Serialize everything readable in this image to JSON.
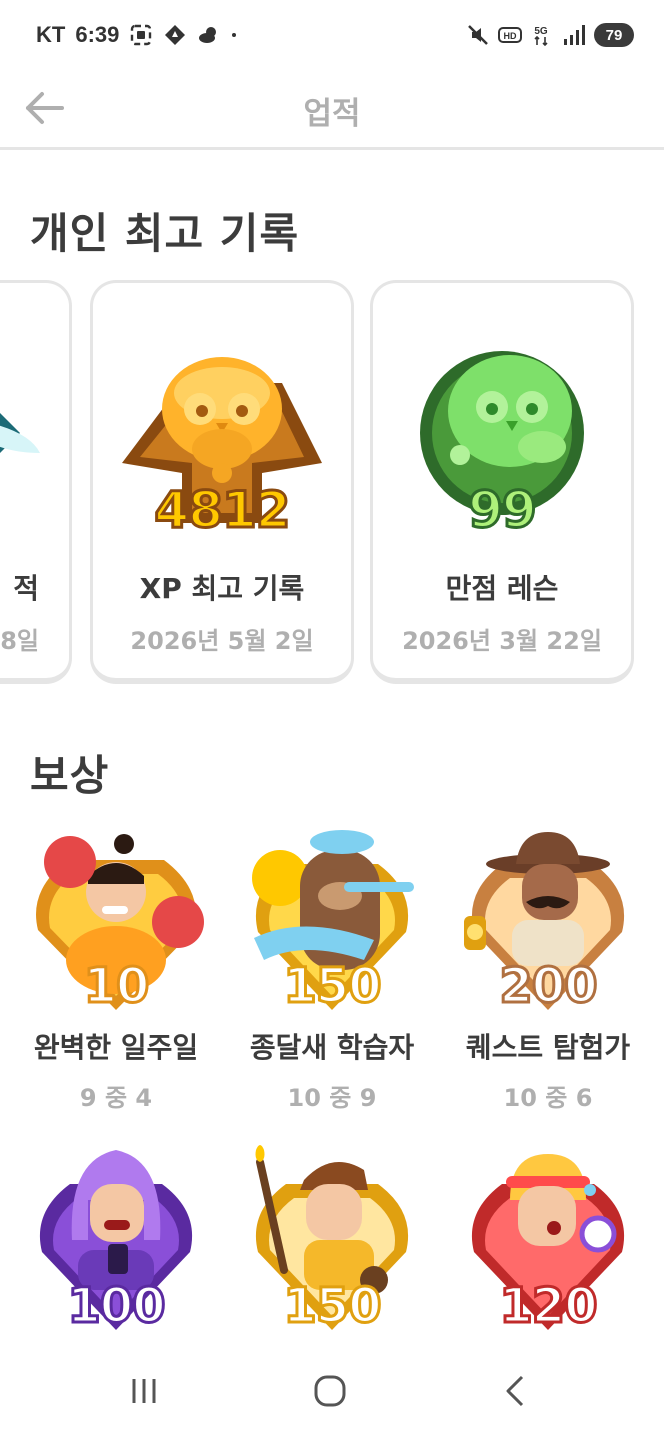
{
  "status_bar": {
    "carrier": "KT",
    "time": "6:39",
    "network": "5G",
    "hd_badge": "HD",
    "battery": "79",
    "left_icons": [
      "screenshot-icon",
      "location-icon",
      "weather-icon",
      "dot-icon"
    ],
    "right_icons": [
      "mute-icon",
      "hd-icon",
      "5g-icon",
      "signal-icon",
      "battery-icon"
    ]
  },
  "header": {
    "title": "업적",
    "back_icon": "arrow-left-icon"
  },
  "personal_records": {
    "title": "개인 최고 기록",
    "cards": [
      {
        "label": "적",
        "date": "8일",
        "value": "",
        "color": "#2fb4c4"
      },
      {
        "label": "XP 최고 기록",
        "date": "2026년 5월 2일",
        "value": "4812",
        "color": "#f5a623"
      },
      {
        "label": "만점 레슨",
        "date": "2026년 3월 22일",
        "value": "99",
        "color": "#58cc02"
      }
    ]
  },
  "awards": {
    "title": "보상",
    "items": [
      {
        "value": "10",
        "title": "완벽한 일주일",
        "progress": "9 중 4",
        "color": "#ffb020",
        "icon": "boxer-badge-icon"
      },
      {
        "value": "150",
        "title": "종달새 학습자",
        "progress": "10 중 9",
        "color": "#ffc800",
        "icon": "bear-badge-icon"
      },
      {
        "value": "200",
        "title": "퀘스트 탐험가",
        "progress": "10 중 6",
        "color": "#f0a050",
        "icon": "explorer-badge-icon"
      },
      {
        "value": "100",
        "title": "",
        "progress": "",
        "color": "#8a4fd8",
        "icon": "purple-badge-icon"
      },
      {
        "value": "150",
        "title": "",
        "progress": "",
        "color": "#ffc800",
        "icon": "painter-badge-icon"
      },
      {
        "value": "120",
        "title": "",
        "progress": "",
        "color": "#ff4b4b",
        "icon": "runner-badge-icon"
      }
    ]
  },
  "navbar": {
    "recents_icon": "recents-icon",
    "home_icon": "home-icon",
    "back_icon": "nav-back-icon"
  }
}
